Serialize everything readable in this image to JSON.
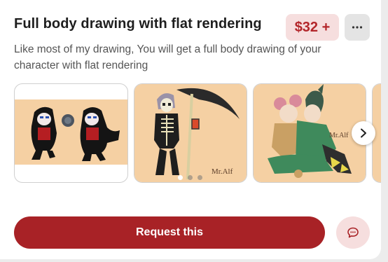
{
  "commission": {
    "title": "Full body drawing with flat rendering",
    "price": "$32 +",
    "description": "Like most of my drawing, You will get a full body drawing of your character with flat rendering"
  },
  "actions": {
    "request_label": "Request this",
    "more_icon": "more-horizontal-icon",
    "chat_icon": "chat-bubble-icon",
    "next_icon": "chevron-right-icon"
  },
  "gallery": {
    "images": [
      {
        "name": "two chibi hooded characters"
      },
      {
        "name": "skeleton with scythe"
      },
      {
        "name": "two characters hugging"
      },
      {
        "name": "partial artwork"
      }
    ],
    "pagination": {
      "count": 3,
      "active": 1
    }
  },
  "signature": "Mr.Alf",
  "colors": {
    "accent": "#a82226",
    "price_bg": "#f6dede",
    "price_text": "#b3262a",
    "artwork_bg": "#f5d0a3"
  }
}
